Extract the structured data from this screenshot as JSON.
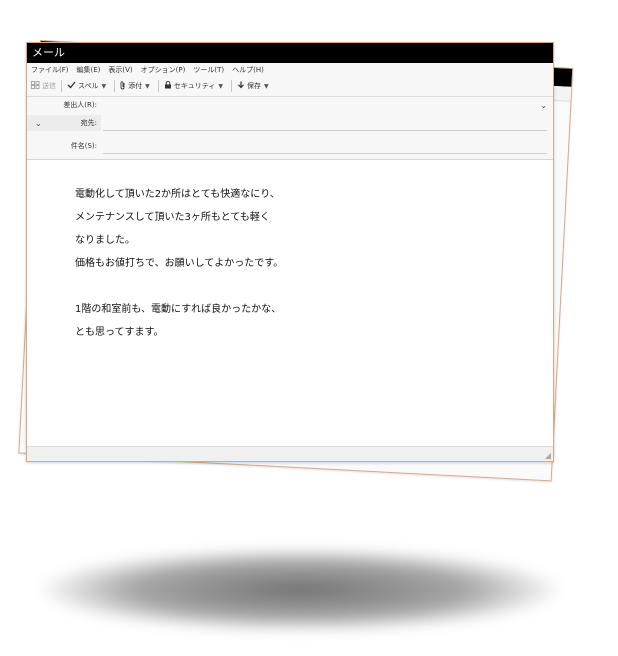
{
  "window": {
    "title": "メール"
  },
  "menu": [
    "ファイル(F)",
    "編集(E)",
    "表示(V)",
    "オプション(P)",
    "ツール(T)",
    "ヘルプ(H)"
  ],
  "toolbar": {
    "send_label": "送信",
    "spell_label": "スペル",
    "attach_label": "添付",
    "security_label": "セキュリティ",
    "save_label": "保存"
  },
  "header": {
    "from_label": "差出人(R):",
    "to_label": "宛先:",
    "subject_label": "件名(S):",
    "from_value": "",
    "to_value": "",
    "subject_value": ""
  },
  "body": {
    "lines": [
      "電動化して頂いた2か所はとても快適なにり、",
      "メンテナンスして頂いた3ヶ所もとても軽く",
      "なりました。",
      "価格もお値打ちで、お願いしてよかったです。",
      "",
      "1階の和室前も、電動にすれば良かったかな、",
      "とも思ってすます。"
    ]
  },
  "icons": {
    "send": "send-icon",
    "spell": "checkmark-icon",
    "attach": "paperclip-icon",
    "security": "lock-icon",
    "save": "download-arrow-icon",
    "dropdown": "chevron-down-icon"
  }
}
